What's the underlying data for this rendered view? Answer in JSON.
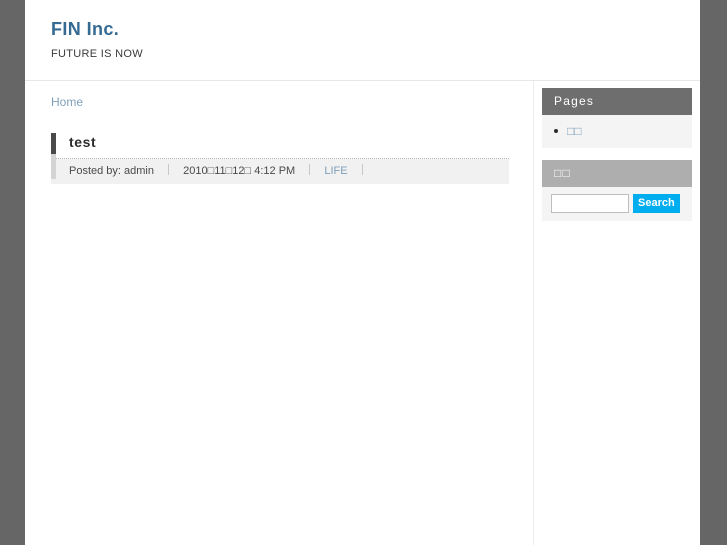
{
  "header": {
    "site_title": "FIN Inc.",
    "tagline": "FUTURE IS NOW",
    "title_color": "#356a92"
  },
  "breadcrumb": {
    "home_label": "Home"
  },
  "post": {
    "title": "test",
    "posted_by_label": "Posted by: admin",
    "date": "2010□11□12□ 4:12 PM",
    "category": "LIFE"
  },
  "sidebar": {
    "pages_widget": {
      "title": "Pages",
      "title_bg": "#6e6e6e",
      "items": [
        {
          "label": "□□"
        }
      ]
    },
    "search_widget": {
      "title": "□□",
      "title_bg": "#aeaeae",
      "input_value": "",
      "input_placeholder": "",
      "button_label": "Search",
      "button_bg": "#00aeef"
    }
  }
}
